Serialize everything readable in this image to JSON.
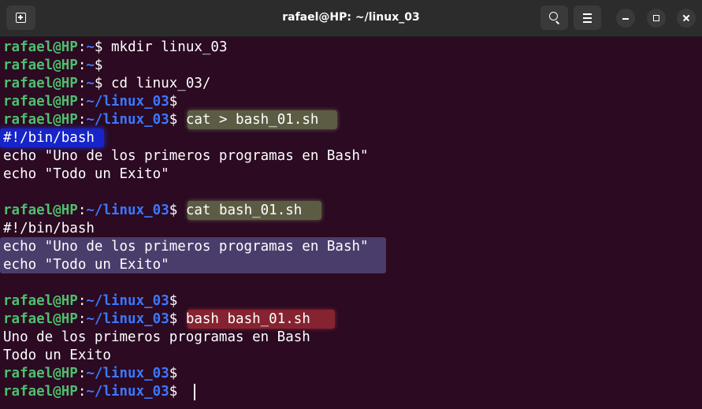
{
  "window": {
    "title": "rafael@HP: ~/linux_03"
  },
  "titlebar": {
    "new_tab_icon": "new-tab-icon",
    "search_icon": "search-icon",
    "menu_icon": "hamburger-menu-icon",
    "minimize_icon": "minimize-icon",
    "maximize_icon": "maximize-icon",
    "close_icon": "close-icon"
  },
  "colors": {
    "terminal_bg": "#2b0a22",
    "user_host": "#4ebf6e",
    "path": "#3b78ff",
    "text": "#ffffff",
    "highlight_command": "#6e7850",
    "highlight_run": "#962832",
    "highlight_shebang": "#1624c9",
    "highlight_echo": "#504678"
  },
  "terminal": {
    "lines": [
      {
        "user": "rafael@HP",
        "sep": ":",
        "path": "~",
        "sign": "$",
        "cmd": " mkdir linux_03"
      },
      {
        "user": "rafael@HP",
        "sep": ":",
        "path": "~",
        "sign": "$",
        "cmd": ""
      },
      {
        "user": "rafael@HP",
        "sep": ":",
        "path": "~",
        "sign": "$",
        "cmd": " cd linux_03/"
      },
      {
        "user": "rafael@HP",
        "sep": ":",
        "path": "~/linux_03",
        "sign": "$",
        "cmd": ""
      },
      {
        "user": "rafael@HP",
        "sep": ":",
        "path": "~/linux_03",
        "sign": "$",
        "cmd": " cat > bash_01.sh"
      },
      {
        "text": "#!/bin/bash"
      },
      {
        "text": "echo \"Uno de los primeros programas en Bash\""
      },
      {
        "text": "echo \"Todo un Exito\""
      },
      {
        "text": ""
      },
      {
        "user": "rafael@HP",
        "sep": ":",
        "path": "~/linux_03",
        "sign": "$",
        "cmd": " cat bash_01.sh"
      },
      {
        "text": "#!/bin/bash"
      },
      {
        "text": "echo \"Uno de los primeros programas en Bash\""
      },
      {
        "text": "echo \"Todo un Exito\""
      },
      {
        "text": ""
      },
      {
        "user": "rafael@HP",
        "sep": ":",
        "path": "~/linux_03",
        "sign": "$",
        "cmd": ""
      },
      {
        "user": "rafael@HP",
        "sep": ":",
        "path": "~/linux_03",
        "sign": "$",
        "cmd": " bash bash_01.sh"
      },
      {
        "text": "Uno de los primeros programas en Bash"
      },
      {
        "text": "Todo un Exito"
      },
      {
        "user": "rafael@HP",
        "sep": ":",
        "path": "~/linux_03",
        "sign": "$",
        "cmd": ""
      },
      {
        "user": "rafael@HP",
        "sep": ":",
        "path": "~/linux_03",
        "sign": "$",
        "cmd": " "
      }
    ]
  }
}
